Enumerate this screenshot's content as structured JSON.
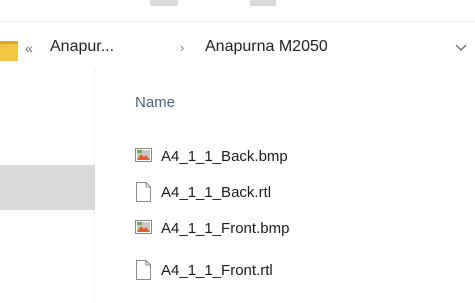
{
  "breadcrumb": {
    "overflow_label": "«",
    "items": [
      {
        "label": "Anapur..."
      },
      {
        "label": "Anapurna M2050"
      }
    ],
    "separator": "›"
  },
  "file_list": {
    "column_header": "Name",
    "files": [
      {
        "name": "A4_1_1_Back.bmp",
        "icon": "bitmap-image-icon"
      },
      {
        "name": "A4_1_1_Back.rtl",
        "icon": "generic-file-icon"
      },
      {
        "name": "A4_1_1_Front.bmp",
        "icon": "bitmap-image-icon"
      },
      {
        "name": "A4_1_1_Front.rtl",
        "icon": "generic-file-icon"
      }
    ]
  },
  "colors": {
    "folder": "#f4c542",
    "nav_selected": "#d9d9d9",
    "header_text": "#4a6079"
  }
}
